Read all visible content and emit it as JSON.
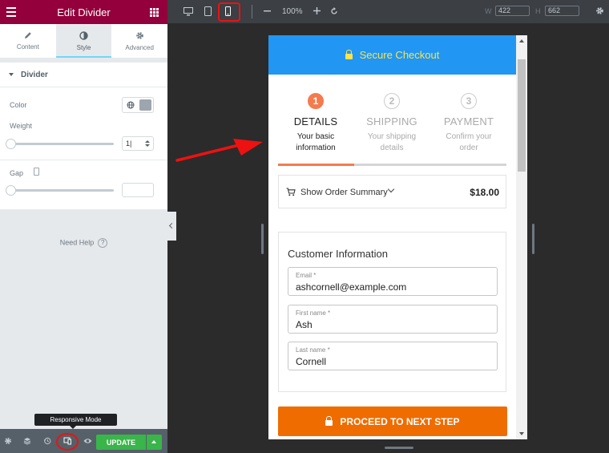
{
  "panel": {
    "title": "Edit Divider",
    "tabs": [
      {
        "label": "Content",
        "icon": "pencil-icon"
      },
      {
        "label": "Style",
        "icon": "half-circle-icon"
      },
      {
        "label": "Advanced",
        "icon": "gear-icon"
      }
    ],
    "section": "Divider",
    "color_label": "Color",
    "color_value": "#9da5ae",
    "weight_label": "Weight",
    "weight_value": "1",
    "gap_label": "Gap",
    "need_help": "Need Help",
    "help_icon": "?"
  },
  "footer": {
    "tooltip": "Responsive Mode",
    "update_label": "UPDATE"
  },
  "toolbar": {
    "zoom": "100%",
    "w_label": "W",
    "w_value": "422",
    "h_label": "H",
    "h_value": "662"
  },
  "checkout": {
    "header": "Secure Checkout",
    "steps": [
      {
        "num": "1",
        "title": "DETAILS",
        "sub_line1": "Your basic",
        "sub_line2": "information",
        "state": "active"
      },
      {
        "num": "2",
        "title": "SHIPPING",
        "sub_line1": "Your shipping",
        "sub_line2": "details",
        "state": "inactive"
      },
      {
        "num": "3",
        "title": "PAYMENT",
        "sub_line1": "Confirm your",
        "sub_line2": "order",
        "state": "inactive"
      }
    ],
    "progress": 0.333,
    "summary_label": "Show Order Summary",
    "summary_price": "$18.00",
    "customer_title": "Customer Information",
    "fields": [
      {
        "label": "Email *",
        "value": "ashcornell@example.com"
      },
      {
        "label": "First name *",
        "value": "Ash"
      },
      {
        "label": "Last name *",
        "value": "Cornell"
      }
    ],
    "proceed_label": "PROCEED TO NEXT STEP"
  },
  "colors": {
    "panel_header": "#93003c",
    "checkout_header": "#2196f3",
    "header_text": "#ffe34c",
    "active_step": "#f37b4e",
    "proceed_button": "#ef6c00",
    "update_button": "#39b54a",
    "highlight": "#ee1111"
  }
}
